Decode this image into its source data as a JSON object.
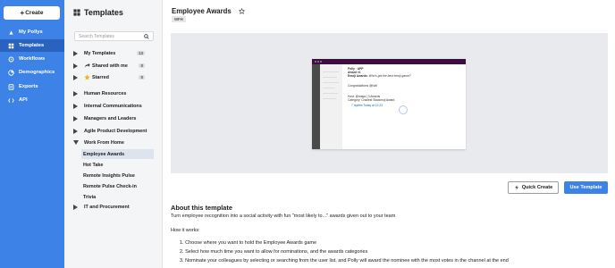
{
  "nav": {
    "create_label": "Create",
    "items": [
      {
        "label": "My Pollys",
        "icon": "polly-icon"
      },
      {
        "label": "Templates",
        "icon": "templates-icon"
      },
      {
        "label": "Workflows",
        "icon": "workflows-icon"
      },
      {
        "label": "Demographics",
        "icon": "demographics-icon"
      },
      {
        "label": "Exports",
        "icon": "exports-icon"
      },
      {
        "label": "API",
        "icon": "api-icon"
      }
    ]
  },
  "templates": {
    "heading": "Templates",
    "search_placeholder": "Search Templates",
    "groups": [
      {
        "label": "My Templates",
        "count": "13"
      },
      {
        "label": "Shared with me",
        "count": "0"
      },
      {
        "label": "Starred",
        "count": "0"
      }
    ],
    "categories": [
      "Human Resources",
      "Internal Communications",
      "Managers and Leaders",
      "Agile Product Development",
      "Work From Home"
    ],
    "work_from_home_items": [
      "Employee Awards",
      "Hot Take",
      "Remote Insights Pulse",
      "Remote Pulse Check-in",
      "Trivia"
    ],
    "last_category": "IT and Procurement"
  },
  "main": {
    "title": "Employee Awards",
    "tag": "WFH",
    "preview": {
      "app_name": "Polly",
      "app_tag": "APP",
      "line1": "Award #1",
      "line2_bold": "Emoji Awards:",
      "line2_rest": "Who's got the best emoji game?",
      "line3": "Congratulations @Kat!",
      "line4": "Host: @maya | 3 Awards",
      "line5": "Category: Craziest Slackmoji Award",
      "line6": "7 replies  Today at 12:23"
    },
    "quick_create_label": "Quick Create",
    "use_template_label": "Use Template",
    "about_heading": "About this template",
    "intro": "Turn employee recognition into a social activity with fun \"most likely to...\" awards given out to your team",
    "how_it_works": "How it works:",
    "steps": [
      "1. Choose where you want to hold the Employee Awards game",
      "2. Select how much time you want to allow for nominations, and the awards categories",
      "3. Nominate your colleagues by selecting or searching from the user list, and Polly will award the nominee with the most votes in the channel at the end"
    ]
  },
  "colors": {
    "nav_bg": "#3d82e6",
    "nav_active": "#2a63bf",
    "primary_button": "#3d82e6"
  }
}
